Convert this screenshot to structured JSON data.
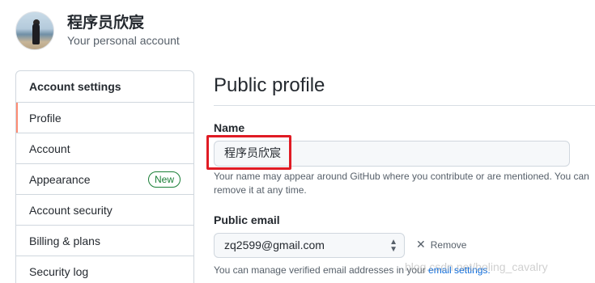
{
  "account": {
    "name": "程序员欣宸",
    "subtitle": "Your personal account"
  },
  "sidebar": {
    "header": "Account settings",
    "items": [
      {
        "label": "Profile",
        "selected": true
      },
      {
        "label": "Account"
      },
      {
        "label": "Appearance",
        "badge": "New"
      },
      {
        "label": "Account security"
      },
      {
        "label": "Billing & plans"
      },
      {
        "label": "Security log"
      }
    ]
  },
  "main": {
    "title": "Public profile",
    "name_label": "Name",
    "name_value": "程序员欣宸",
    "name_note": "Your name may appear around GitHub where you contribute or are mentioned. You can remove it at any time.",
    "email_label": "Public email",
    "email_value": "zq2599@gmail.com",
    "remove_label": "Remove",
    "email_note_prefix": "You can manage verified email addresses in your ",
    "email_note_link": "email settings."
  },
  "watermark": "blog.csdn.net/boling_cavalry",
  "colors": {
    "accent_selected": "#fd8c73",
    "badge_green": "#1a7f37",
    "link": "#0969da",
    "highlight_red": "#e01b24"
  },
  "icons": {
    "remove": "x-icon",
    "select": "select-arrows-icon"
  }
}
